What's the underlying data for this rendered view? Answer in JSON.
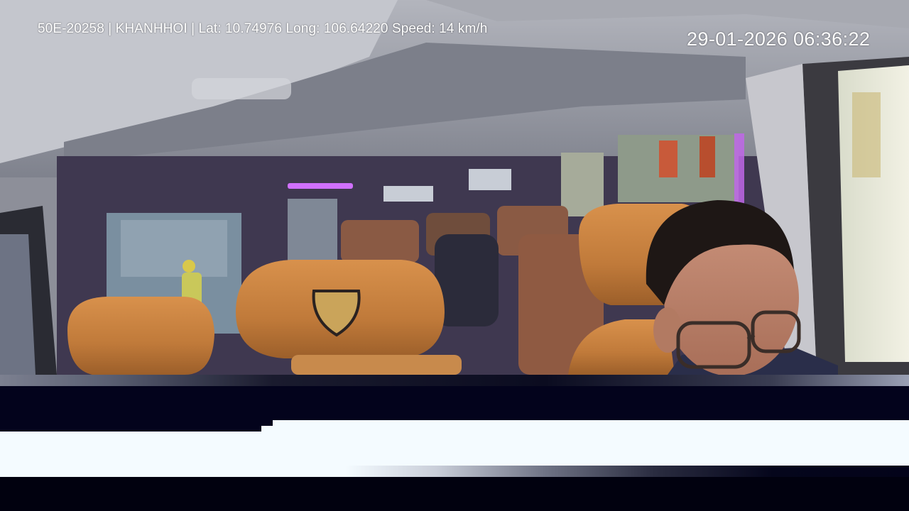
{
  "overlay": {
    "info_text": "50E-20258 | KHANHHOI | Lat: 10.74976 Long: 106.64220 Speed: 14 km/h",
    "timestamp": "29-01-2026 06:36:22"
  },
  "colors": {
    "headrest": "#c9823f",
    "interior_gray": "#8d8f99",
    "accent_led": "#d070ff",
    "band_dark": "#03031c",
    "band_white": "#f4fbff"
  }
}
